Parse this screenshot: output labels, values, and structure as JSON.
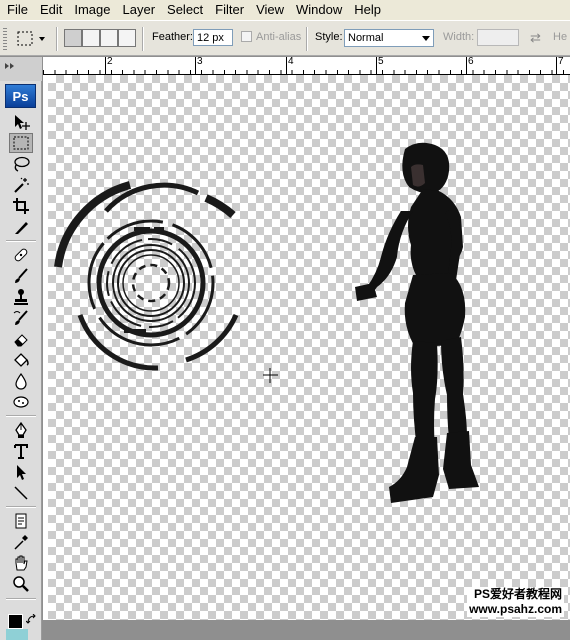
{
  "menu": [
    "File",
    "Edit",
    "Image",
    "Layer",
    "Select",
    "Filter",
    "View",
    "Window",
    "Help"
  ],
  "options": {
    "feather_label": "Feather:",
    "feather_value": "12 px",
    "antialias_label": "Anti-alias",
    "style_label": "Style:",
    "style_value": "Normal",
    "width_label": "Width:",
    "height_label": "He"
  },
  "toolbox": {
    "logo": "Ps",
    "tools": [
      "move-tool",
      "marquee-tool",
      "lasso-tool",
      "magic-wand-tool",
      "crop-tool",
      "eyedropper-tool",
      "healing-brush-tool",
      "brush-tool",
      "clone-stamp-tool",
      "history-brush-tool",
      "eraser-tool",
      "paint-bucket-tool",
      "blur-tool",
      "dodge-tool",
      "pen-tool",
      "type-tool",
      "path-selection-tool",
      "line-tool",
      "notes-tool",
      "eyedropper2-tool",
      "hand-tool",
      "zoom-tool"
    ],
    "foreground_color": "#000000",
    "background_color": "#8fd0d6"
  },
  "ruler": {
    "labels": [
      "2",
      "3",
      "4",
      "5",
      "6",
      "7"
    ]
  },
  "watermark": {
    "line1": "PS爱好者教程网",
    "line2": "www.psahz.com"
  }
}
